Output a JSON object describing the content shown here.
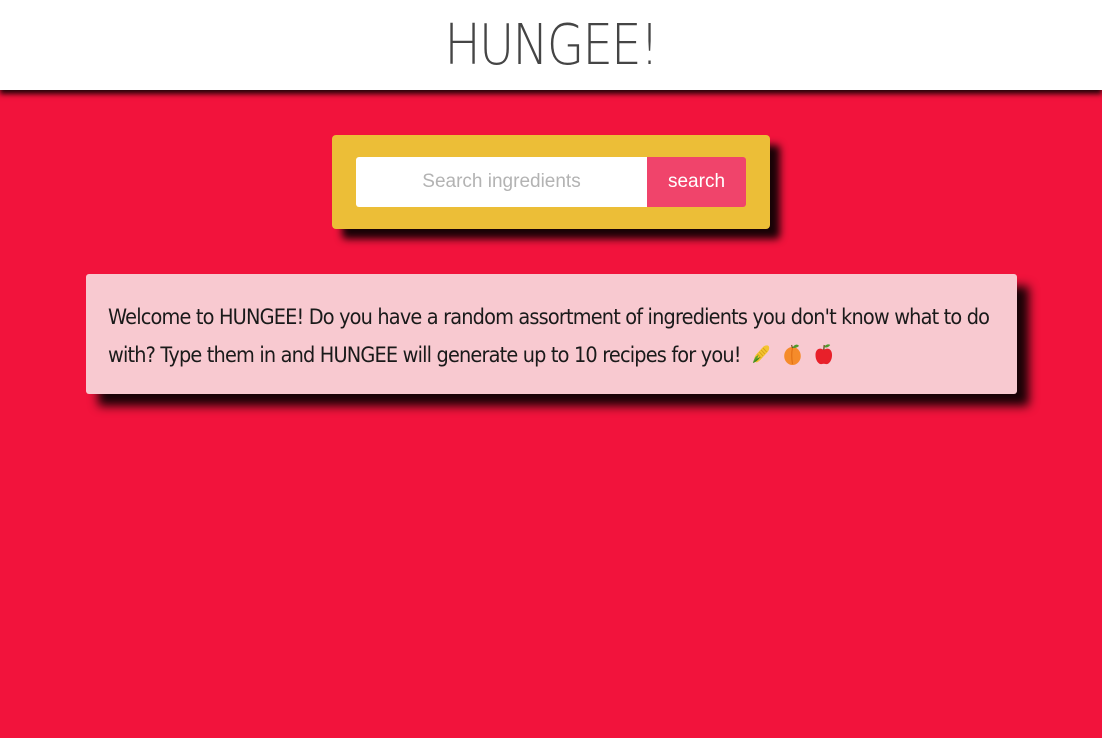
{
  "header": {
    "title": "HUNGEE!"
  },
  "search": {
    "placeholder": "Search ingredients",
    "value": "",
    "button_label": "search"
  },
  "welcome": {
    "message": "Welcome to HUNGEE! Do you have a random assortment of ingredients you don't know what to do with? Type them in and HUNGEE will generate up to 10 recipes for you!",
    "emoji_icons": [
      "corn-icon",
      "peach-icon",
      "apple-icon"
    ]
  },
  "colors": {
    "background": "#f2133c",
    "header": "#ffffff",
    "search_panel": "#ecbe37",
    "search_button": "#f0446b",
    "welcome_card": "#f8c9d0",
    "title_text": "#454545"
  }
}
